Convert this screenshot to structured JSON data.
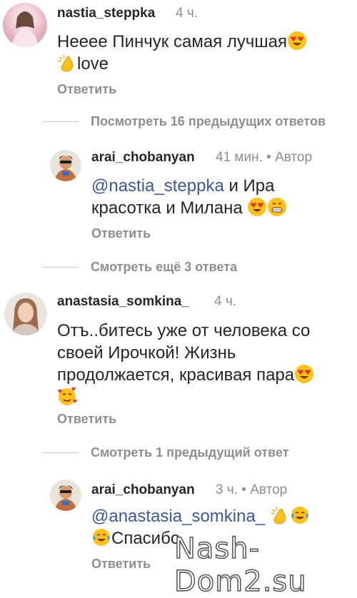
{
  "comments": [
    {
      "username": "nastia_steppka",
      "time": "4 ч.",
      "text_line1": "Неeee Пинчук самая лучшая",
      "text_line2": "love",
      "reply_label": "Ответить"
    },
    {
      "more_replies": "Посмотреть 16 предыдущих ответов",
      "username": "arai_chobanyan",
      "time": "41 мин. • Автор",
      "mention": "@nastia_steppka",
      "text_line1_rest": " и Ира",
      "text_line2": "красотка и Милана",
      "reply_label": "Ответить"
    },
    {
      "more_replies": "Смотреть ещё 3 ответа"
    },
    {
      "username": "anastasia_somkina_",
      "time": "4 ч.",
      "text_line1": "Отъ..битесь уже от человека со",
      "text_line2": "своей Ирочкой! Жизнь",
      "text_line3": "продолжается, красивая пара",
      "reply_label": "Ответить"
    },
    {
      "more_replies": "Смотреть 1 предыдущий ответ",
      "username": "arai_chobanyan",
      "time": "3 ч. • Автор",
      "mention": "@anastasia_somkina_",
      "text_line2": "Спасибо",
      "reply_label": "Ответить"
    }
  ],
  "watermark": "Nash-Dom2.su",
  "colors": {
    "text": "#262626",
    "secondary": "#8e8e8e",
    "mention": "#3b5998"
  }
}
